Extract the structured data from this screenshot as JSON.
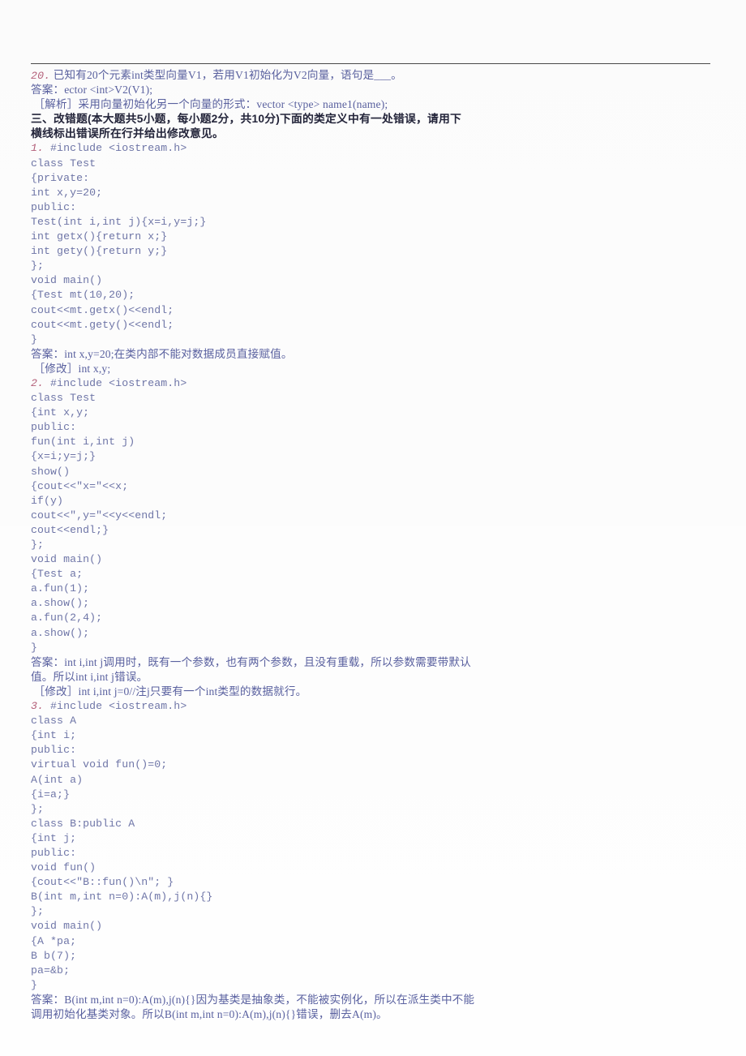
{
  "document": {
    "type": "scanned-exam-answer-sheet",
    "language": "zh-CN",
    "subject_hint": "C++",
    "text_color": "#6f76a8",
    "heading_color": "#23243a",
    "number_color": "#b5607a",
    "rule_color": "#4a4a4a"
  },
  "lines": [
    {
      "id": "l01",
      "num": "20.",
      "text": " 已知有20个元素int类型向量V1，若用V1初始化为V2向量，语句是___。",
      "style": "cn"
    },
    {
      "id": "l02",
      "num": "",
      "text": "答案：ector <int>V2(V1);",
      "style": "cn"
    },
    {
      "id": "l03",
      "num": "",
      "text": " ［解析］采用向量初始化另一个向量的形式：vector <type> name1(name);",
      "style": "cn"
    },
    {
      "id": "l04",
      "num": "",
      "text": "三、改错题(本大题共5小题，每小题2分，共10分)下面的类定义中有一处错误，请用下",
      "style": "heading"
    },
    {
      "id": "l05",
      "num": "",
      "text": "横线标出错误所在行并给出修改意见。",
      "style": "heading"
    },
    {
      "id": "l06",
      "num": "1.",
      "text": " #include <iostream.h>",
      "style": "code"
    },
    {
      "id": "l07",
      "num": "",
      "text": "class Test",
      "style": "code"
    },
    {
      "id": "l08",
      "num": "",
      "text": "{private:",
      "style": "code"
    },
    {
      "id": "l09",
      "num": "",
      "text": "int x,y=20;",
      "style": "code"
    },
    {
      "id": "l10",
      "num": "",
      "text": "public:",
      "style": "code"
    },
    {
      "id": "l11",
      "num": "",
      "text": "Test(int i,int j){x=i,y=j;}",
      "style": "code"
    },
    {
      "id": "l12",
      "num": "",
      "text": "int getx(){return x;}",
      "style": "code"
    },
    {
      "id": "l13",
      "num": "",
      "text": "int gety(){return y;}",
      "style": "code"
    },
    {
      "id": "l14",
      "num": "",
      "text": "};",
      "style": "code"
    },
    {
      "id": "l15",
      "num": "",
      "text": "void main()",
      "style": "code"
    },
    {
      "id": "l16",
      "num": "",
      "text": "{Test mt(10,20);",
      "style": "code"
    },
    {
      "id": "l17",
      "num": "",
      "text": "cout<<mt.getx()<<endl;",
      "style": "code"
    },
    {
      "id": "l18",
      "num": "",
      "text": "cout<<mt.gety()<<endl;",
      "style": "code"
    },
    {
      "id": "l19",
      "num": "",
      "text": "}",
      "style": "code"
    },
    {
      "id": "l20",
      "num": "",
      "text": "答案：int x,y=20;在类内部不能对数据成员直接赋值。",
      "style": "cn"
    },
    {
      "id": "l21",
      "num": "",
      "text": " ［修改］int x,y;",
      "style": "cn"
    },
    {
      "id": "l22",
      "num": "2.",
      "text": " #include <iostream.h>",
      "style": "code"
    },
    {
      "id": "l23",
      "num": "",
      "text": "class Test",
      "style": "code"
    },
    {
      "id": "l24",
      "num": "",
      "text": "{int x,y;",
      "style": "code"
    },
    {
      "id": "l25",
      "num": "",
      "text": "public:",
      "style": "code"
    },
    {
      "id": "l26",
      "num": "",
      "text": "fun(int i,int j)",
      "style": "code"
    },
    {
      "id": "l27",
      "num": "",
      "text": "{x=i;y=j;}",
      "style": "code"
    },
    {
      "id": "l28",
      "num": "",
      "text": "show()",
      "style": "code"
    },
    {
      "id": "l29",
      "num": "",
      "text": "{cout<<\"x=\"<<x;",
      "style": "code"
    },
    {
      "id": "l30",
      "num": "",
      "text": "if(y)",
      "style": "code"
    },
    {
      "id": "l31",
      "num": "",
      "text": "cout<<\",y=\"<<y<<endl;",
      "style": "code"
    },
    {
      "id": "l32",
      "num": "",
      "text": "cout<<endl;}",
      "style": "code"
    },
    {
      "id": "l33",
      "num": "",
      "text": "};",
      "style": "code"
    },
    {
      "id": "l34",
      "num": "",
      "text": "void main()",
      "style": "code"
    },
    {
      "id": "l35",
      "num": "",
      "text": "{Test a;",
      "style": "code"
    },
    {
      "id": "l36",
      "num": "",
      "text": "a.fun(1);",
      "style": "code"
    },
    {
      "id": "l37",
      "num": "",
      "text": "a.show();",
      "style": "code"
    },
    {
      "id": "l38",
      "num": "",
      "text": "a.fun(2,4);",
      "style": "code"
    },
    {
      "id": "l39",
      "num": "",
      "text": "a.show();",
      "style": "code"
    },
    {
      "id": "l40",
      "num": "",
      "text": "}",
      "style": "code"
    },
    {
      "id": "l41",
      "num": "",
      "text": "答案：int i,int j调用时，既有一个参数，也有两个参数，且没有重载，所以参数需要带默认",
      "style": "cn"
    },
    {
      "id": "l42",
      "num": "",
      "text": "值。所以int i,int j错误。",
      "style": "cn"
    },
    {
      "id": "l43",
      "num": "",
      "text": " ［修改］int i,int j=0//注j只要有一个int类型的数据就行。",
      "style": "cn"
    },
    {
      "id": "l44",
      "num": "3.",
      "text": " #include <iostream.h>",
      "style": "code"
    },
    {
      "id": "l45",
      "num": "",
      "text": "class A",
      "style": "code"
    },
    {
      "id": "l46",
      "num": "",
      "text": "{int i;",
      "style": "code"
    },
    {
      "id": "l47",
      "num": "",
      "text": "public:",
      "style": "code"
    },
    {
      "id": "l48",
      "num": "",
      "text": "virtual void fun()=0;",
      "style": "code"
    },
    {
      "id": "l49",
      "num": "",
      "text": "A(int a)",
      "style": "code"
    },
    {
      "id": "l50",
      "num": "",
      "text": "{i=a;}",
      "style": "code"
    },
    {
      "id": "l51",
      "num": "",
      "text": "};",
      "style": "code"
    },
    {
      "id": "l52",
      "num": "",
      "text": "class B:public A",
      "style": "code"
    },
    {
      "id": "l53",
      "num": "",
      "text": "{int j;",
      "style": "code"
    },
    {
      "id": "l54",
      "num": "",
      "text": "public:",
      "style": "code"
    },
    {
      "id": "l55",
      "num": "",
      "text": "void fun()",
      "style": "code"
    },
    {
      "id": "l56",
      "num": "",
      "text": "{cout<<\"B::fun()\\n\"; }",
      "style": "code"
    },
    {
      "id": "l57",
      "num": "",
      "text": "B(int m,int n=0):A(m),j(n){}",
      "style": "code"
    },
    {
      "id": "l58",
      "num": "",
      "text": "};",
      "style": "code"
    },
    {
      "id": "l59",
      "num": "",
      "text": "void main()",
      "style": "code"
    },
    {
      "id": "l60",
      "num": "",
      "text": "{A *pa;",
      "style": "code"
    },
    {
      "id": "l61",
      "num": "",
      "text": "B b(7);",
      "style": "code"
    },
    {
      "id": "l62",
      "num": "",
      "text": "pa=&b;",
      "style": "code"
    },
    {
      "id": "l63",
      "num": "",
      "text": "}",
      "style": "code"
    },
    {
      "id": "l64",
      "num": "",
      "text": "答案：B(int m,int n=0):A(m),j(n){}因为基类是抽象类，不能被实例化，所以在派生类中不能",
      "style": "cn"
    },
    {
      "id": "l65",
      "num": "",
      "text": "调用初始化基类对象。所以B(int m,int n=0):A(m),j(n){}错误，删去A(m)。",
      "style": "cn"
    }
  ]
}
